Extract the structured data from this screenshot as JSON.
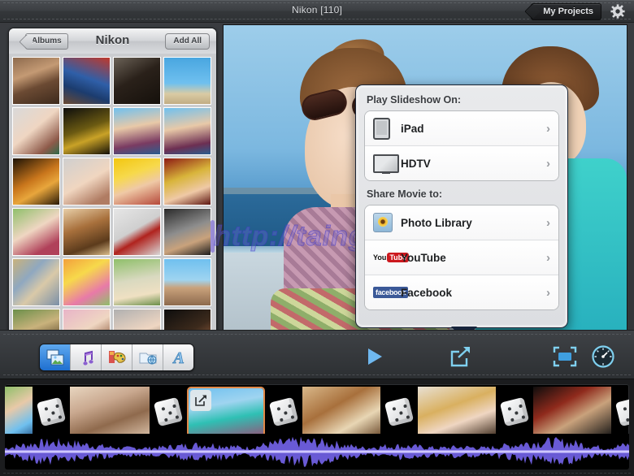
{
  "window": {
    "title": "Nikon  [110]",
    "my_projects_label": "My Projects",
    "gear_icon": "gear-icon"
  },
  "browser": {
    "back_label": "Albums",
    "title": "Nikon",
    "add_all_label": "Add All",
    "grid": {
      "columns": 4,
      "thumbnails": [
        {
          "name": "cafe-people",
          "css": "linear-gradient(160deg,#8d6a4d 0%,#c49a74 35%,#6b4a33 60%,#3d2a1c 100%)"
        },
        {
          "name": "kids-baseball",
          "css": "linear-gradient(200deg,#c0392b 0%,#2f5fa8 45%,#1c3c6e 70%,#6b4a33 100%)"
        },
        {
          "name": "driftwood",
          "css": "linear-gradient(150deg,#6b6257 0%,#2a211a 45%,#15100b 100%)"
        },
        {
          "name": "seagull-sky",
          "css": "linear-gradient(#49a6e0 0%,#6fc0ef 55%,#d9cba4 78%,#c2ad84 100%)"
        },
        {
          "name": "woman-portrait",
          "css": "linear-gradient(140deg,#d9d9d9 0%,#efd6c2 45%,#8e5a4a 80%,#2e6b4a 100%)"
        },
        {
          "name": "night-street",
          "css": "linear-gradient(160deg,#0d0d0d 0%,#6b5a12 45%,#c9a227 65%,#141007 100%)"
        },
        {
          "name": "girls-pool-drink",
          "css": "linear-gradient(170deg,#6fc0ef 0%,#e8c9a8 40%,#7a3b62 75%,#2b5d8f 100%)"
        },
        {
          "name": "girl-pool-drink-2",
          "css": "linear-gradient(170deg,#6fc0ef 0%,#e8c9a8 42%,#6d2f52 78%,#2b5d8f 100%)"
        },
        {
          "name": "autumn-woman",
          "css": "linear-gradient(150deg,#1c1205 0%,#c9761c 45%,#e8a63c 65%,#2a1a07 100%)"
        },
        {
          "name": "smiling-woman",
          "css": "linear-gradient(150deg,#cfcfcf 0%,#f0d6c0 50%,#b07c63 85%)"
        },
        {
          "name": "woman-yellow-bg",
          "css": "linear-gradient(160deg,#f2c60f 0%,#f7d94b 35%,#efc9a6 60%,#b5483a 100%)"
        },
        {
          "name": "woman-red-curtain",
          "css": "linear-gradient(160deg,#8d1a14 0%,#d8b43a 40%,#efc9a6 70%,#5c1410 100%)"
        },
        {
          "name": "woman-green-bg",
          "css": "linear-gradient(150deg,#8fbf6a 0%,#efd6c2 45%,#b0415a 80%)"
        },
        {
          "name": "chocolates",
          "css": "linear-gradient(160deg,#e8cfa8 0%,#a8703c 40%,#5c3b1c 75%,#d9bb8a 100%)"
        },
        {
          "name": "red-dahlia-table",
          "css": "linear-gradient(150deg,#e6e6e6 0%,#cfcfcf 45%,#b0231e 62%,#d9d9d9 100%)"
        },
        {
          "name": "man-grey-suit",
          "css": "linear-gradient(160deg,#2a2a2a 0%,#8d8d8d 45%,#c9a27c 70%,#1c1c1c 100%)"
        },
        {
          "name": "ornate-pattern",
          "css": "linear-gradient(135deg,#c9b27c 0%,#8fa8c0 35%,#d9c9a8 60%,#7a8fa8 100%)"
        },
        {
          "name": "flowers-bouquet",
          "css": "linear-gradient(150deg,#f2a03c 0%,#f7d94b 35%,#e87aa8 70%,#8fbf6a 100%)"
        },
        {
          "name": "girl-in-field",
          "css": "linear-gradient(170deg,#8fbf6a 0%,#d9d9c0 45%,#efe0c2 75%,#6b8f4a 100%)"
        },
        {
          "name": "people-on-rock",
          "css": "linear-gradient(#6fc0ef 0%,#9fd4f0 45%,#c9a27c 62%,#8d6a4d 100%)"
        },
        {
          "name": "wooden-house",
          "css": "linear-gradient(160deg,#6b8f4a 0%,#c9b27c 40%,#5c4a2c 75%)"
        },
        {
          "name": "girl-flower-crown",
          "css": "linear-gradient(150deg,#e8b4c8 0%,#efd6c2 45%,#8d5a3c 80%)"
        },
        {
          "name": "girl-glasses",
          "css": "linear-gradient(160deg,#b0b0b0 0%,#efd6c2 50%,#6b5a4a 85%)"
        },
        {
          "name": "dark-portrait",
          "css": "linear-gradient(150deg,#0d0d0d 0%,#3c2a1c 50%,#8d5a3c 80%,#0d0d0d 100%)"
        }
      ]
    }
  },
  "preview": {
    "name": "slideshow-preview",
    "watermark": "http://taingay.vn/"
  },
  "popover": {
    "sections": [
      {
        "title": "Play Slideshow On:",
        "items": [
          {
            "label": "iPad",
            "icon": "ipad-icon"
          },
          {
            "label": "HDTV",
            "icon": "hdtv-icon"
          }
        ]
      },
      {
        "title": "Share Movie to:",
        "items": [
          {
            "label": "Photo Library",
            "icon": "photo-library-icon"
          },
          {
            "label": "YouTube",
            "icon": "youtube-icon"
          },
          {
            "label": "Facebook",
            "icon": "facebook-icon"
          }
        ]
      }
    ],
    "chevron": "›",
    "youtube_logo": {
      "you": "You",
      "tube": "Tube"
    },
    "facebook_logo": "facebook"
  },
  "toolbar": {
    "segments": [
      {
        "name": "photos-button",
        "icon": "photos-icon",
        "selected": true
      },
      {
        "name": "music-button",
        "icon": "music-note-icon",
        "selected": false
      },
      {
        "name": "themes-button",
        "icon": "palette-icon",
        "selected": false
      },
      {
        "name": "web-button",
        "icon": "globe-folder-icon",
        "selected": false
      },
      {
        "name": "text-button",
        "icon": "text-a-icon",
        "selected": false
      }
    ],
    "controls": [
      {
        "name": "play-button",
        "icon": "play-icon"
      },
      {
        "name": "share-button",
        "icon": "share-icon"
      },
      {
        "name": "fullscreen-button",
        "icon": "fullscreen-icon"
      },
      {
        "name": "speed-button",
        "icon": "speedometer-icon"
      }
    ]
  },
  "timeline": {
    "clips": [
      {
        "name": "clip-flowers-edge",
        "width": 34,
        "css": "linear-gradient(150deg,#8fbf6a 0%,#e8c9a8 40%,#6fc0ef 75%,#2b5d8f 100%)",
        "selected": false
      },
      {
        "name": "clip-girl-teddy",
        "width": 98,
        "css": "linear-gradient(160deg,#e8d6c0 0%,#c9a88f 35%,#8f6a4d 65%,#d9c0a8 100%)",
        "selected": false
      },
      {
        "name": "clip-two-kids-beach",
        "width": 96,
        "css": "linear-gradient(170deg,#6fc0ef 0%,#9fd4f0 35%,#2fc0b4 62%,#8f5a7c 100%)",
        "selected": true
      },
      {
        "name": "clip-pastries",
        "width": 96,
        "css": "linear-gradient(150deg,#d9b88a 0%,#a8703c 40%,#e8d6b4 70%,#6b4a2c 100%)",
        "selected": false
      },
      {
        "name": "clip-blonde-woman",
        "width": 96,
        "css": "linear-gradient(160deg,#e8e0d4 0%,#d9b060 40%,#efd6c2 65%,#3c2a1c 100%)",
        "selected": false
      },
      {
        "name": "clip-boxer",
        "width": 96,
        "css": "linear-gradient(150deg,#0d0d0d 0%,#8f2a1c 35%,#c9a27c 60%,#141414 100%)",
        "selected": false
      },
      {
        "name": "clip-last-partial",
        "width": 22,
        "css": "linear-gradient(160deg,#c9761c 0%,#e8b44a 50%,#3c2a1c 100%)",
        "selected": false
      }
    ],
    "transition_icon": "dice-transition-icon",
    "edit_badge_icon": "edit-pencil-icon",
    "audio_track": {
      "name": "audio-waveform",
      "color": "#6f5fe0"
    }
  }
}
